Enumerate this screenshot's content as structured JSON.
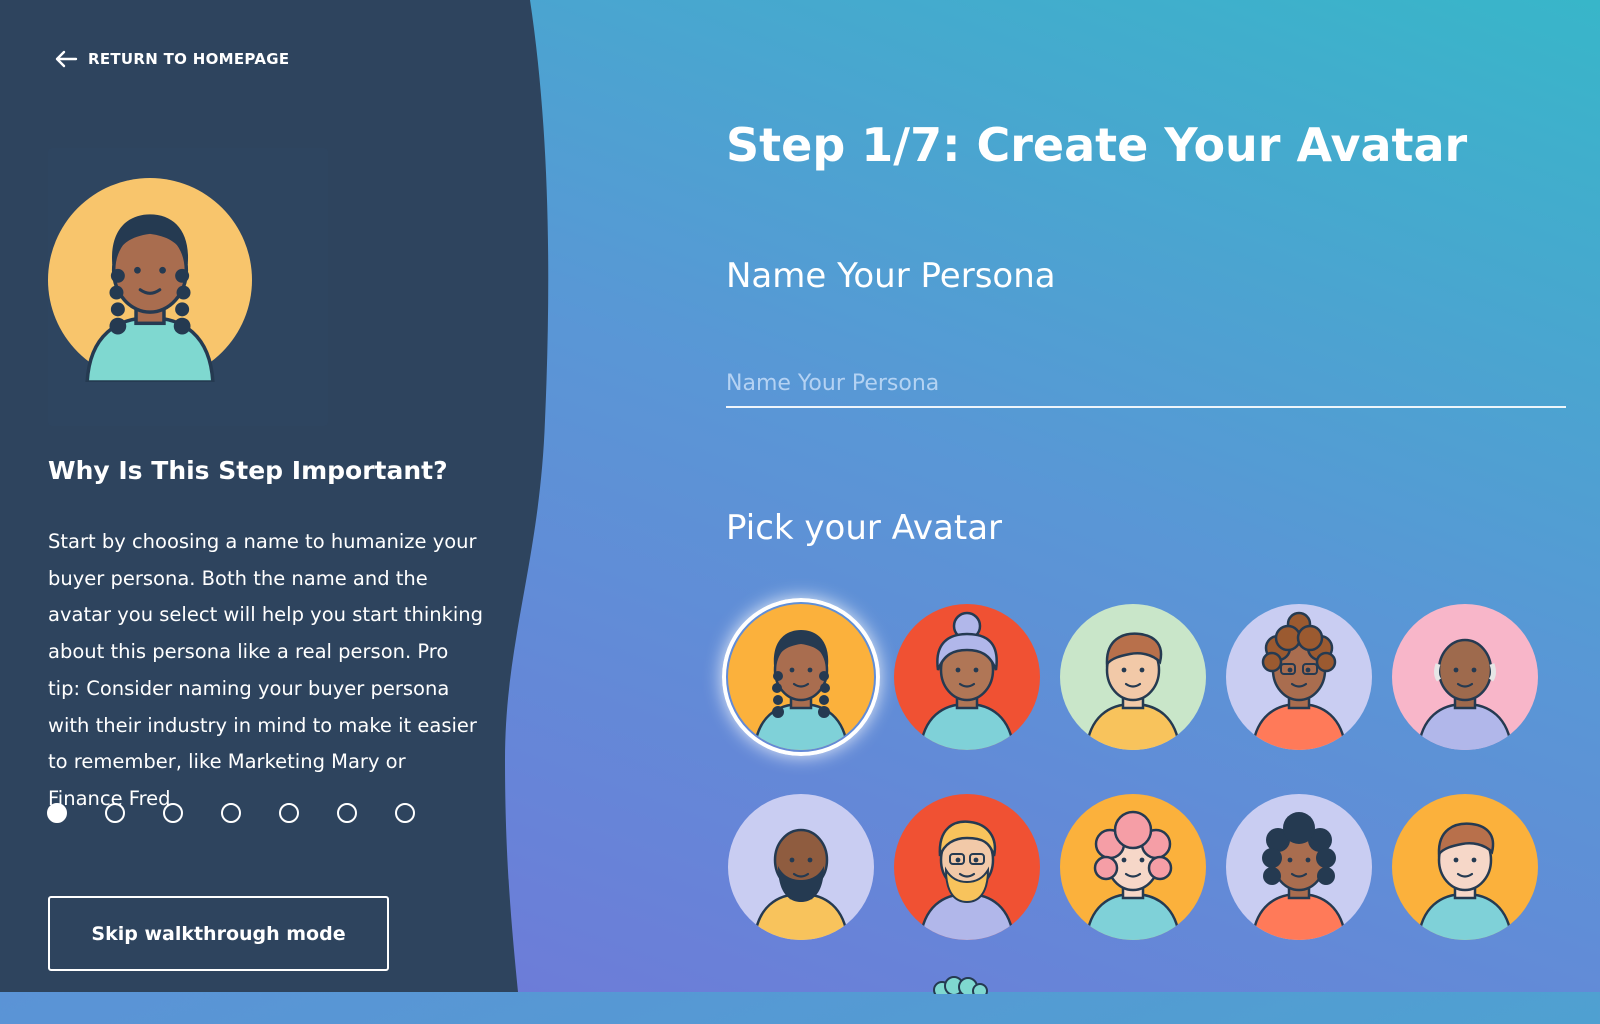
{
  "nav": {
    "return_label": "RETURN TO HOMEPAGE"
  },
  "sidebar": {
    "heading": "Why Is This Step Important?",
    "body": "Start by choosing a name to humanize your buyer persona. Both the name and the avatar you select will help you start thinking about this persona like a real person. Pro tip: Consider naming your buyer persona with their industry in mind to make it easier to remember, like Marketing Mary or Finance Fred",
    "steps_total": 7,
    "steps_current": 1,
    "skip_label": "Skip walkthrough mode"
  },
  "main": {
    "title": "Step 1/7: Create Your Avatar",
    "name_section": "Name Your Persona",
    "name_input": {
      "value": "",
      "placeholder": "Name Your Persona"
    },
    "avatar_section": "Pick your Avatar"
  },
  "avatars": [
    {
      "id": "avatar-braids",
      "bg": "#fbb13c",
      "skin": "#a96d4f",
      "hair": "#253a51",
      "shirt": "#7fd1d8",
      "style": "braids",
      "selected": true
    },
    {
      "id": "avatar-bun-gray",
      "bg": "#f05133",
      "skin": "#b07656",
      "hair": "#b1b7ea",
      "shirt": "#7fd1d8",
      "style": "bun",
      "selected": false
    },
    {
      "id": "avatar-swoop",
      "bg": "#c9e6c9",
      "skin": "#f2c9a8",
      "hair": "#b8704b",
      "shirt": "#f8c35c",
      "style": "swoop",
      "selected": false
    },
    {
      "id": "avatar-curly-glasses",
      "bg": "#c9cdf2",
      "skin": "#a96d4f",
      "hair": "#9b5a30",
      "shirt": "#ff7a59",
      "style": "curly",
      "selected": false
    },
    {
      "id": "avatar-bald-elder",
      "bg": "#f8b6c9",
      "skin": "#9e6a4d",
      "hair": "#e6e6e6",
      "shirt": "#b1b7ea",
      "style": "bald",
      "selected": false
    },
    {
      "id": "avatar-beard",
      "bg": "#c9cdf2",
      "skin": "#8f5c3f",
      "hair": "#253a51",
      "shirt": "#f8c35c",
      "style": "beard",
      "selected": false
    },
    {
      "id": "avatar-blond-glasses",
      "bg": "#f05133",
      "skin": "#f2c9a8",
      "hair": "#f8c35c",
      "shirt": "#b1b7ea",
      "style": "blond",
      "selected": false
    },
    {
      "id": "avatar-pink-hair",
      "bg": "#fbb13c",
      "skin": "#f6d7c8",
      "hair": "#f59ea6",
      "shirt": "#7fd1d8",
      "style": "pink",
      "selected": false
    },
    {
      "id": "avatar-dark-curls",
      "bg": "#c9cdf2",
      "skin": "#a96d4f",
      "hair": "#253a51",
      "shirt": "#ff7a59",
      "style": "darkcurl",
      "selected": false
    },
    {
      "id": "avatar-brown-hair",
      "bg": "#fbb13c",
      "skin": "#f6d7c8",
      "hair": "#b8704b",
      "shirt": "#7fd1d8",
      "style": "swoop",
      "selected": false
    }
  ]
}
